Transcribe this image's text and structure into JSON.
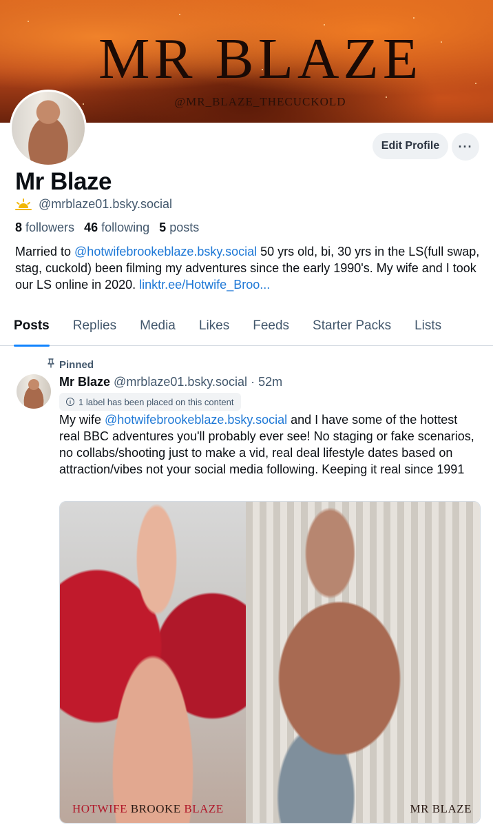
{
  "banner": {
    "title": "MR BLAZE",
    "subtitle": "@MR_BLAZE_THECUCKOLD"
  },
  "profile": {
    "display_name": "Mr Blaze",
    "handle": "@mrblaze01.bsky.social",
    "edit_label": "Edit Profile",
    "more_label": "···",
    "stats": {
      "followers_count": "8",
      "followers_label": "followers",
      "following_count": "46",
      "following_label": "following",
      "posts_count": "5",
      "posts_label": "posts"
    },
    "bio": {
      "prefix": "Married to ",
      "mention": "@hotwifebrookeblaze.bsky.social",
      "middle": " 50 yrs old, bi, 30 yrs in the LS(full swap, stag, cuckold) been filming my adventures since the early 1990's. My wife and I took our LS online in 2020. ",
      "link": "linktr.ee/Hotwife_Broo..."
    }
  },
  "tabs": [
    {
      "label": "Posts",
      "active": true
    },
    {
      "label": "Replies"
    },
    {
      "label": "Media"
    },
    {
      "label": "Likes"
    },
    {
      "label": "Feeds"
    },
    {
      "label": "Starter Packs"
    },
    {
      "label": "Lists"
    }
  ],
  "post": {
    "pinned_label": "Pinned",
    "author_name": "Mr Blaze",
    "author_handle": "@mrblaze01.bsky.social",
    "separator": "·",
    "time": "52m",
    "label_notice": "1 label has been placed on this content",
    "text_prefix": "My wife ",
    "text_mention": "@hotwifebrookeblaze.bsky.social",
    "text_rest": " and I have some of the hottest real BBC adventures you'll probably ever see! No staging or fake scenarios, no collabs/shooting just to make a vid, real deal lifestyle dates based on attraction/vibes not your social media following. Keeping it real since 1991",
    "media_caption_left_a": "HOTWIFE",
    "media_caption_left_b": "BROOKE",
    "media_caption_left_c": "BLAZE",
    "media_caption_right": "MR BLAZE"
  },
  "colors": {
    "accent": "#1083fe",
    "link": "#1e78d6",
    "muted_text": "#42576c"
  },
  "icons": {
    "handle_badge": "sunrise-icon",
    "pin": "pin-icon",
    "label_info": "info-icon",
    "more": "ellipsis-icon"
  }
}
